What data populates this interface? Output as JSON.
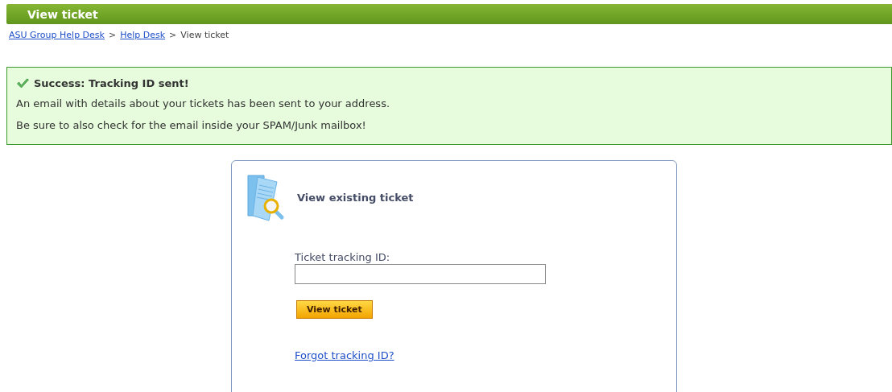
{
  "header": {
    "title": "View ticket"
  },
  "breadcrumb": [
    {
      "kind": "link",
      "text": "ASU Group Help Desk"
    },
    {
      "kind": "separator",
      "text": ">"
    },
    {
      "kind": "link",
      "text": "Help Desk"
    },
    {
      "kind": "separator",
      "text": ">"
    },
    {
      "kind": "current",
      "text": "View ticket"
    }
  ],
  "notice": {
    "kind": "success",
    "title": "Success: Tracking ID sent!",
    "paragraphs": [
      "An email with details about your tickets has been sent to your address.",
      "Be sure to also check for the email inside your SPAM/Junk mailbox!"
    ]
  },
  "card": {
    "title": "View existing ticket",
    "field": {
      "label": "Ticket tracking ID:"
    },
    "button": "View ticket",
    "link": "Forgot tracking ID?"
  }
}
